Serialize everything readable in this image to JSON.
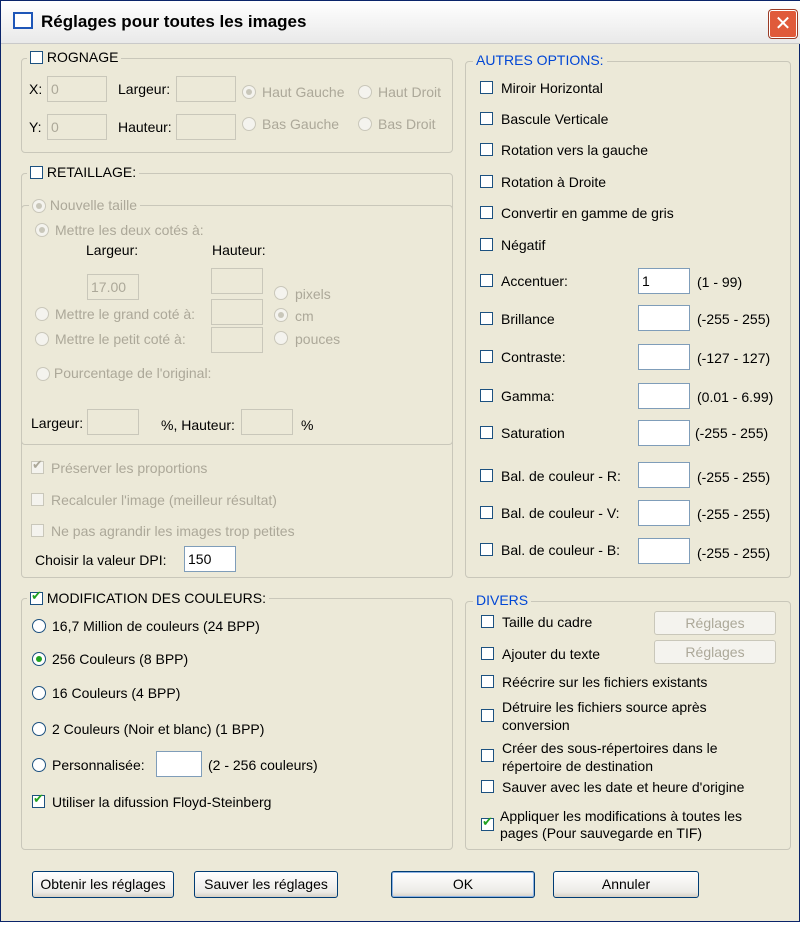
{
  "dialog": {
    "title": "Réglages pour toutes les images",
    "close_glyph": "✕"
  },
  "crop": {
    "legend": "ROGNAGE",
    "checked": false,
    "x_label": "X:",
    "x_value": "0",
    "y_label": "Y:",
    "y_value": "0",
    "width_label": "Largeur:",
    "height_label": "Hauteur:",
    "anchor_top_left": "Haut Gauche",
    "anchor_top_right": "Haut Droit",
    "anchor_bottom_left": "Bas Gauche",
    "anchor_bottom_right": "Bas Droit"
  },
  "resize": {
    "legend": "RETAILLAGE:",
    "checked": false,
    "new_size": "Nouvelle taille",
    "both_sides": "Mettre les deux cotés à:",
    "col_width": "Largeur:",
    "col_height": "Hauteur:",
    "width_value": "17.00",
    "long_side": "Mettre le grand coté à:",
    "short_side": "Mettre le petit coté à:",
    "unit_pixels": "pixels",
    "unit_cm": "cm",
    "unit_inches": "pouces",
    "percent_of_original": "Pourcentage de l'original:",
    "pct_width_label": "Largeur:",
    "pct_sep": "%, Hauteur:",
    "pct_end": "%",
    "keep_proportions": "Préserver les proportions",
    "recalc_image": "Recalculer l'image (meilleur résultat)",
    "no_enlarge": "Ne pas agrandir les images trop petites",
    "dpi_label": "Choisir la valeur DPI:",
    "dpi_value": "150"
  },
  "colors": {
    "legend": "MODIFICATION DES COULEURS:",
    "checked": true,
    "opt_24bpp": "16,7 Million de couleurs (24 BPP)",
    "opt_8bpp": "256 Couleurs (8 BPP)",
    "opt_4bpp": "16 Couleurs (4 BPP)",
    "opt_1bpp": "2 Couleurs (Noir et blanc) (1 BPP)",
    "opt_custom": "Personnalisée:",
    "custom_range": "(2 - 256 couleurs)",
    "selected": "256 Couleurs (8 BPP)",
    "floyd": "Utiliser la difussion Floyd-Steinberg"
  },
  "other": {
    "legend": "AUTRES OPTIONS:",
    "mirror_h": "Miroir Horizontal",
    "flip_v": "Bascule Verticale",
    "rotate_left": "Rotation vers la gauche",
    "rotate_right": "Rotation à Droite",
    "grayscale": "Convertir en gamme de gris",
    "negative": "Négatif",
    "sharpen": "Accentuer:",
    "sharpen_value": "1",
    "sharpen_range": "(1 - 99)",
    "brightness": "Brillance",
    "brightness_range": "(-255 - 255)",
    "contrast": "Contraste:",
    "contrast_range": "(-127 - 127)",
    "gamma": "Gamma:",
    "gamma_range": "(0.01 - 6.99)",
    "saturation": "Saturation",
    "saturation_range": "(-255  -  255)",
    "bal_r": "Bal. de couleur - R:",
    "bal_r_range": "(-255  -  255)",
    "bal_v": "Bal. de couleur - V:",
    "bal_v_range": "(-255  -  255)",
    "bal_b": "Bal. de couleur - B:",
    "bal_b_range": "(-255  -  255)"
  },
  "misc": {
    "legend": "DIVERS",
    "frame_size": "Taille du cadre",
    "add_text": "Ajouter du texte",
    "settings_button": "Réglages",
    "overwrite": "Réécrire sur les fichiers existants",
    "delete_source_1": "Détruire les fichiers source après",
    "delete_source_2": "conversion",
    "subdirs_1": "Créer des sous-répertoires dans le",
    "subdirs_2": "répertoire de destination",
    "keep_date": "Sauver  avec les date et heure d'origine",
    "apply_all_1": "Appliquer les modifications à toutes les",
    "apply_all_2": "pages (Pour sauvegarde en TIF)",
    "apply_all_checked": true
  },
  "buttons": {
    "load": "Obtenir les réglages",
    "save": "Sauver les réglages",
    "ok": "OK",
    "cancel": "Annuler"
  },
  "colors_theme": {
    "accent": "#0046d5",
    "check": "#21a121",
    "close": "#e05a3a"
  }
}
